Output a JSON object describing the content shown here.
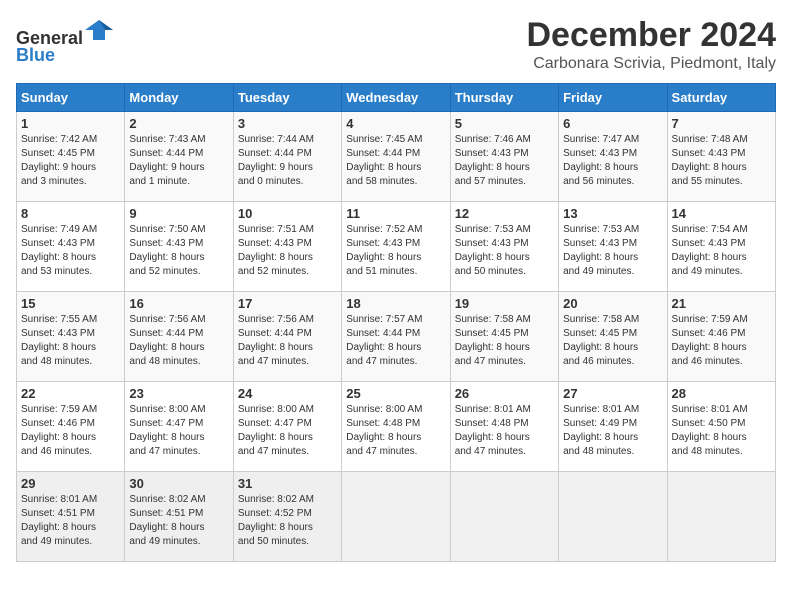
{
  "header": {
    "logo_general": "General",
    "logo_blue": "Blue",
    "main_title": "December 2024",
    "sub_title": "Carbonara Scrivia, Piedmont, Italy"
  },
  "columns": [
    "Sunday",
    "Monday",
    "Tuesday",
    "Wednesday",
    "Thursday",
    "Friday",
    "Saturday"
  ],
  "weeks": [
    [
      {
        "day": "1",
        "info": "Sunrise: 7:42 AM\nSunset: 4:45 PM\nDaylight: 9 hours\nand 3 minutes."
      },
      {
        "day": "2",
        "info": "Sunrise: 7:43 AM\nSunset: 4:44 PM\nDaylight: 9 hours\nand 1 minute."
      },
      {
        "day": "3",
        "info": "Sunrise: 7:44 AM\nSunset: 4:44 PM\nDaylight: 9 hours\nand 0 minutes."
      },
      {
        "day": "4",
        "info": "Sunrise: 7:45 AM\nSunset: 4:44 PM\nDaylight: 8 hours\nand 58 minutes."
      },
      {
        "day": "5",
        "info": "Sunrise: 7:46 AM\nSunset: 4:43 PM\nDaylight: 8 hours\nand 57 minutes."
      },
      {
        "day": "6",
        "info": "Sunrise: 7:47 AM\nSunset: 4:43 PM\nDaylight: 8 hours\nand 56 minutes."
      },
      {
        "day": "7",
        "info": "Sunrise: 7:48 AM\nSunset: 4:43 PM\nDaylight: 8 hours\nand 55 minutes."
      }
    ],
    [
      {
        "day": "8",
        "info": "Sunrise: 7:49 AM\nSunset: 4:43 PM\nDaylight: 8 hours\nand 53 minutes."
      },
      {
        "day": "9",
        "info": "Sunrise: 7:50 AM\nSunset: 4:43 PM\nDaylight: 8 hours\nand 52 minutes."
      },
      {
        "day": "10",
        "info": "Sunrise: 7:51 AM\nSunset: 4:43 PM\nDaylight: 8 hours\nand 52 minutes."
      },
      {
        "day": "11",
        "info": "Sunrise: 7:52 AM\nSunset: 4:43 PM\nDaylight: 8 hours\nand 51 minutes."
      },
      {
        "day": "12",
        "info": "Sunrise: 7:53 AM\nSunset: 4:43 PM\nDaylight: 8 hours\nand 50 minutes."
      },
      {
        "day": "13",
        "info": "Sunrise: 7:53 AM\nSunset: 4:43 PM\nDaylight: 8 hours\nand 49 minutes."
      },
      {
        "day": "14",
        "info": "Sunrise: 7:54 AM\nSunset: 4:43 PM\nDaylight: 8 hours\nand 49 minutes."
      }
    ],
    [
      {
        "day": "15",
        "info": "Sunrise: 7:55 AM\nSunset: 4:43 PM\nDaylight: 8 hours\nand 48 minutes."
      },
      {
        "day": "16",
        "info": "Sunrise: 7:56 AM\nSunset: 4:44 PM\nDaylight: 8 hours\nand 48 minutes."
      },
      {
        "day": "17",
        "info": "Sunrise: 7:56 AM\nSunset: 4:44 PM\nDaylight: 8 hours\nand 47 minutes."
      },
      {
        "day": "18",
        "info": "Sunrise: 7:57 AM\nSunset: 4:44 PM\nDaylight: 8 hours\nand 47 minutes."
      },
      {
        "day": "19",
        "info": "Sunrise: 7:58 AM\nSunset: 4:45 PM\nDaylight: 8 hours\nand 47 minutes."
      },
      {
        "day": "20",
        "info": "Sunrise: 7:58 AM\nSunset: 4:45 PM\nDaylight: 8 hours\nand 46 minutes."
      },
      {
        "day": "21",
        "info": "Sunrise: 7:59 AM\nSunset: 4:46 PM\nDaylight: 8 hours\nand 46 minutes."
      }
    ],
    [
      {
        "day": "22",
        "info": "Sunrise: 7:59 AM\nSunset: 4:46 PM\nDaylight: 8 hours\nand 46 minutes."
      },
      {
        "day": "23",
        "info": "Sunrise: 8:00 AM\nSunset: 4:47 PM\nDaylight: 8 hours\nand 47 minutes."
      },
      {
        "day": "24",
        "info": "Sunrise: 8:00 AM\nSunset: 4:47 PM\nDaylight: 8 hours\nand 47 minutes."
      },
      {
        "day": "25",
        "info": "Sunrise: 8:00 AM\nSunset: 4:48 PM\nDaylight: 8 hours\nand 47 minutes."
      },
      {
        "day": "26",
        "info": "Sunrise: 8:01 AM\nSunset: 4:48 PM\nDaylight: 8 hours\nand 47 minutes."
      },
      {
        "day": "27",
        "info": "Sunrise: 8:01 AM\nSunset: 4:49 PM\nDaylight: 8 hours\nand 48 minutes."
      },
      {
        "day": "28",
        "info": "Sunrise: 8:01 AM\nSunset: 4:50 PM\nDaylight: 8 hours\nand 48 minutes."
      }
    ],
    [
      {
        "day": "29",
        "info": "Sunrise: 8:01 AM\nSunset: 4:51 PM\nDaylight: 8 hours\nand 49 minutes."
      },
      {
        "day": "30",
        "info": "Sunrise: 8:02 AM\nSunset: 4:51 PM\nDaylight: 8 hours\nand 49 minutes."
      },
      {
        "day": "31",
        "info": "Sunrise: 8:02 AM\nSunset: 4:52 PM\nDaylight: 8 hours\nand 50 minutes."
      },
      {
        "day": "",
        "info": ""
      },
      {
        "day": "",
        "info": ""
      },
      {
        "day": "",
        "info": ""
      },
      {
        "day": "",
        "info": ""
      }
    ]
  ]
}
